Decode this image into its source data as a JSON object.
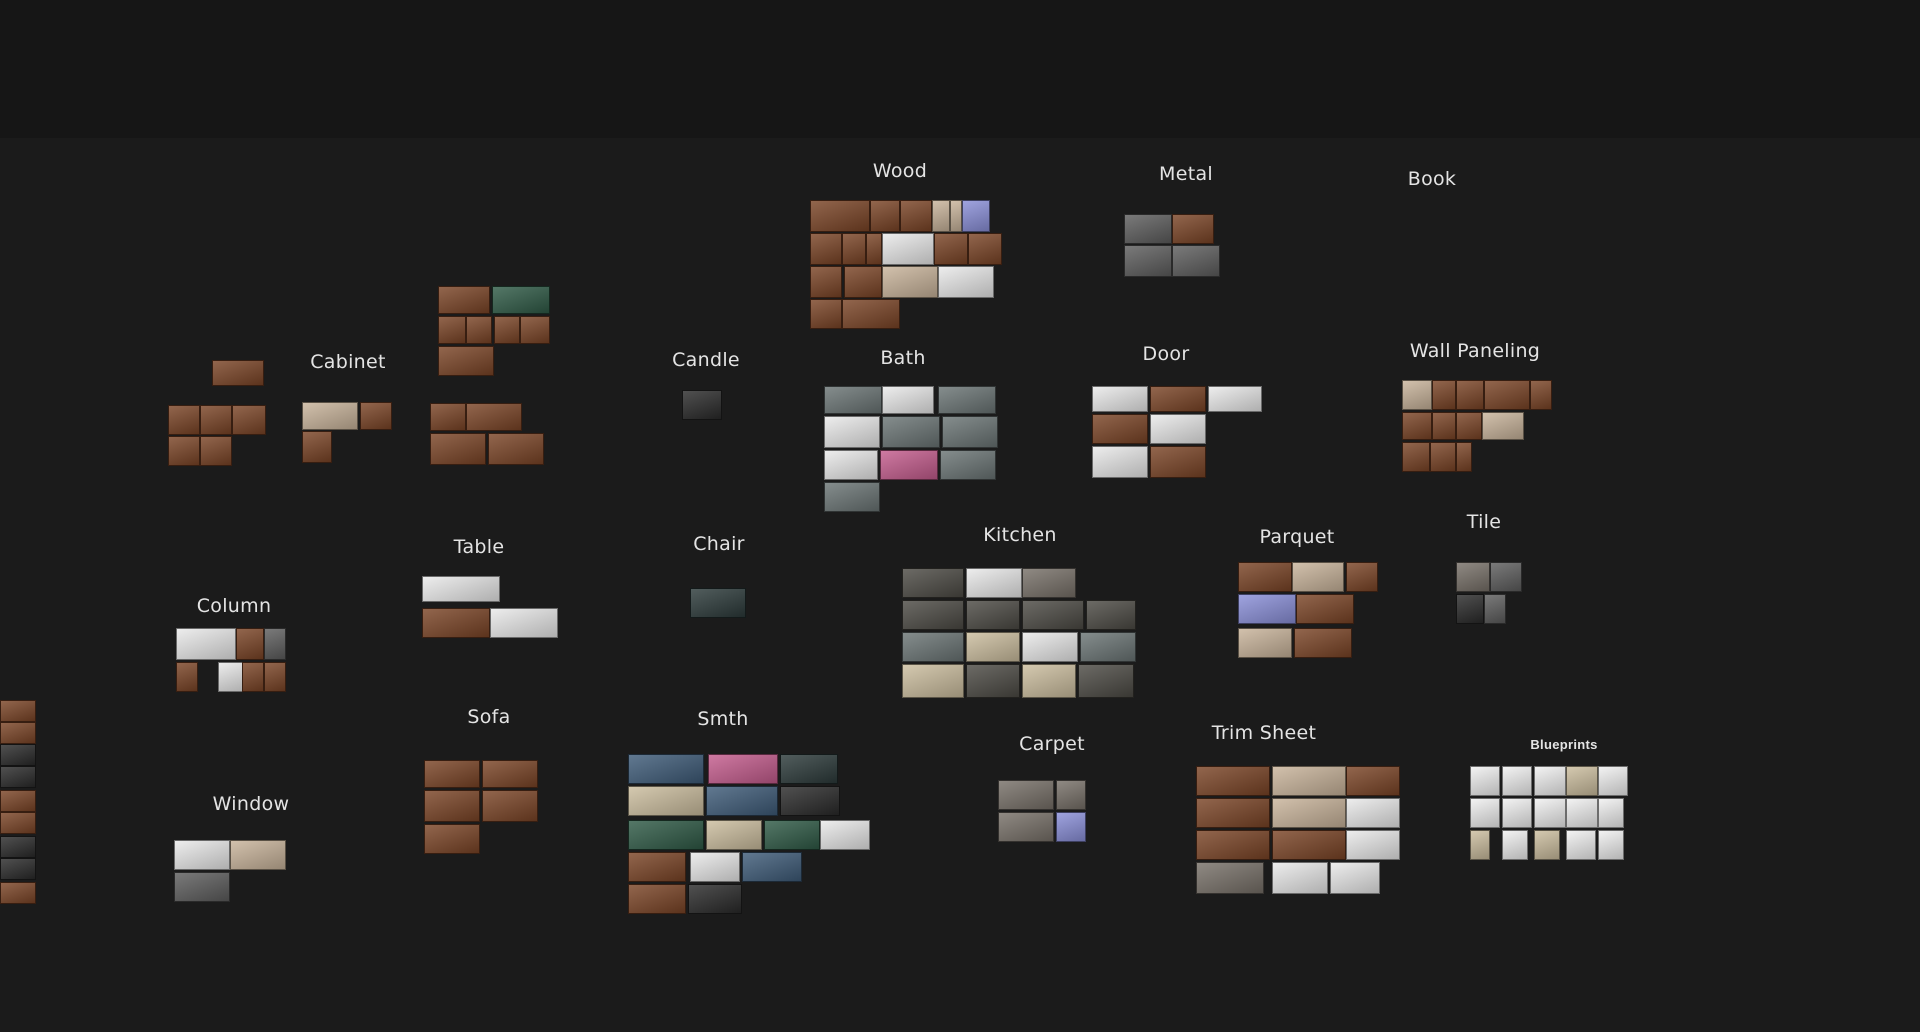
{
  "board": {
    "background": "#1b1b1b",
    "top_bar_color": "#161616"
  },
  "labels": {
    "wood": "Wood",
    "metal": "Metal",
    "book": "Book",
    "cabinet": "Cabinet",
    "candle": "Candle",
    "bath": "Bath",
    "door": "Door",
    "wall_paneling": "Wall Paneling",
    "table": "Table",
    "chair": "Chair",
    "kitchen": "Kitchen",
    "parquet": "Parquet",
    "tile": "Tile",
    "column": "Column",
    "sofa": "Sofa",
    "smth": "Smth",
    "carpet": "Carpet",
    "trim_sheet": "Trim Sheet",
    "blueprints": "Blueprints",
    "window": "Window"
  },
  "swatch_colors": {
    "wood": "#7a4426",
    "wood_light": "#c8b39a",
    "white": "#e9e9e9",
    "metal": "#5d5d5d",
    "teal_dark": "#2c3a3a",
    "bath": "#6a7474",
    "kitchen": "#4c4a44",
    "beige": "#cbbd9e",
    "blue": "#8a8fd8",
    "pink": "#c45c8d",
    "smth_blue": "#3e5b78",
    "green": "#2f5a46",
    "dark": "#2a2a2a",
    "stone": "#777068",
    "paper": "#f0f0f0"
  }
}
